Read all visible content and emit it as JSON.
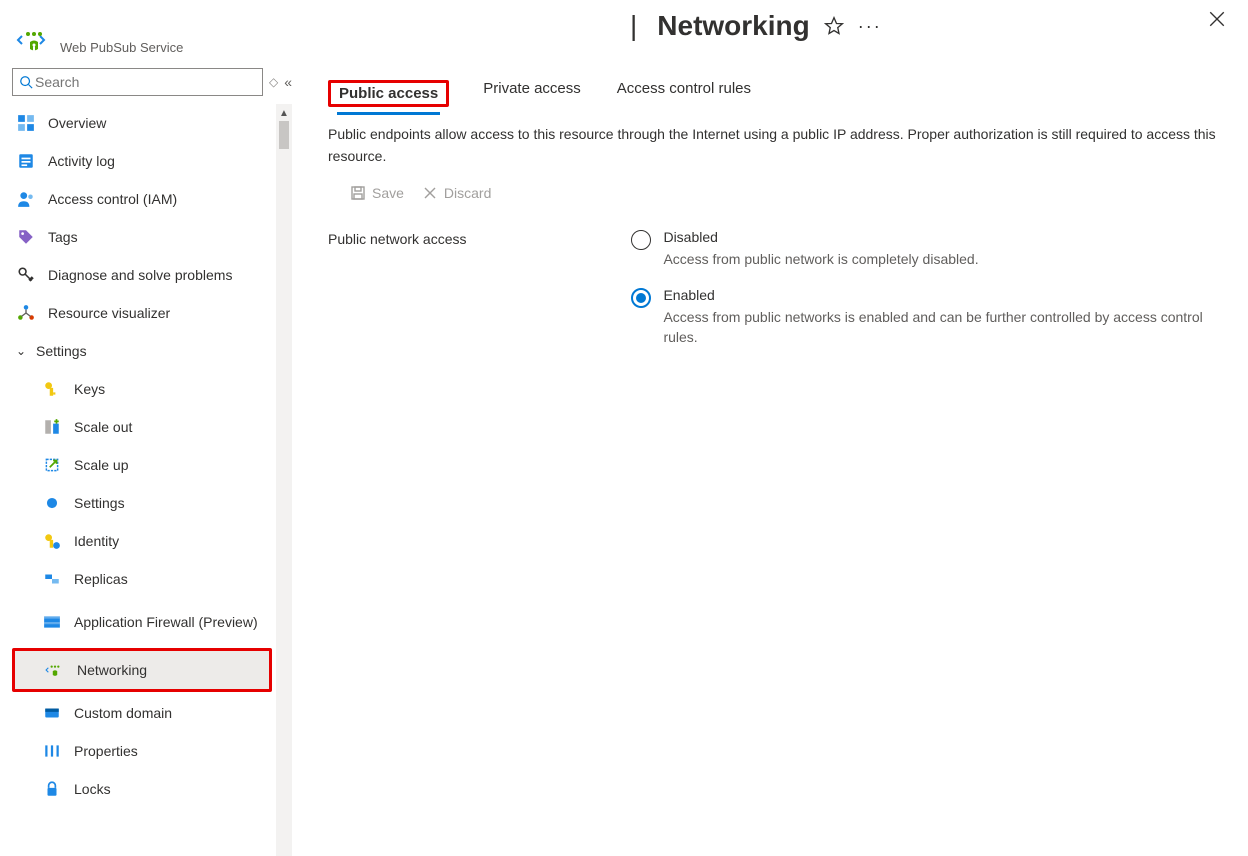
{
  "header": {
    "service_name": "Web PubSub Service",
    "title_separator": "|",
    "page_title": "Networking"
  },
  "sidebar": {
    "search_placeholder": "Search",
    "items": [
      {
        "label": "Overview"
      },
      {
        "label": "Activity log"
      },
      {
        "label": "Access control (IAM)"
      },
      {
        "label": "Tags"
      },
      {
        "label": "Diagnose and solve problems"
      },
      {
        "label": "Resource visualizer"
      }
    ],
    "settings_group_label": "Settings",
    "settings_items": [
      {
        "label": "Keys"
      },
      {
        "label": "Scale out"
      },
      {
        "label": "Scale up"
      },
      {
        "label": "Settings"
      },
      {
        "label": "Identity"
      },
      {
        "label": "Replicas"
      },
      {
        "label": "Application Firewall (Preview)"
      },
      {
        "label": "Networking"
      },
      {
        "label": "Custom domain"
      },
      {
        "label": "Properties"
      },
      {
        "label": "Locks"
      }
    ]
  },
  "main": {
    "tabs": {
      "public_access": "Public access",
      "private_access": "Private access",
      "acr": "Access control rules"
    },
    "description": "Public endpoints allow access to this resource through the Internet using a public IP address. Proper authorization is still required to access this resource.",
    "toolbar": {
      "save": "Save",
      "discard": "Discard"
    },
    "form_label": "Public network access",
    "options": {
      "disabled": {
        "title": "Disabled",
        "desc": "Access from public network is completely disabled."
      },
      "enabled": {
        "title": "Enabled",
        "desc": "Access from public networks is enabled and can be further controlled by access control rules."
      }
    }
  }
}
